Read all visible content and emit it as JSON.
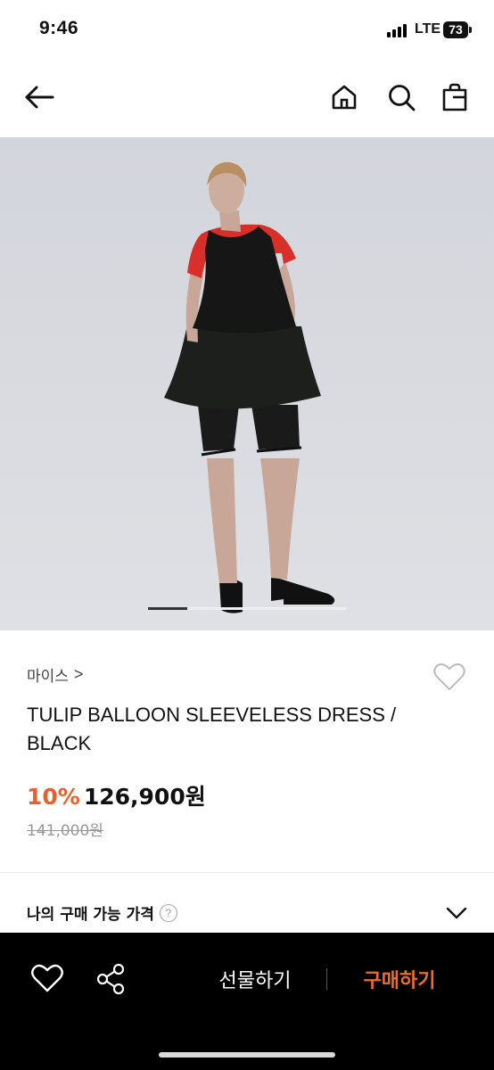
{
  "status_bar": {
    "time": "9:46",
    "network": "LTE",
    "battery": "73"
  },
  "nav": {
    "back_icon": "arrow-left-icon",
    "home_icon": "home-icon",
    "search_icon": "search-icon",
    "cart_icon": "shopping-bag-icon"
  },
  "gallery": {
    "progress": 0.2
  },
  "product": {
    "brand": "마이스",
    "brand_chevron": ">",
    "title": "TULIP BALLOON SLEEVELESS DRESS / BLACK",
    "discount": "10%",
    "sale_price": "126,900원",
    "original_price": "141,000원"
  },
  "price_check": {
    "label": "나의 구매 가능 가격",
    "help": "?"
  },
  "bottom_bar": {
    "gift_label": "선물하기",
    "buy_label": "구매하기"
  },
  "colors": {
    "accent": "#e8602c",
    "buy": "#f06a2c",
    "bar": "#000000",
    "gallery_bg": "#d6d8de"
  }
}
